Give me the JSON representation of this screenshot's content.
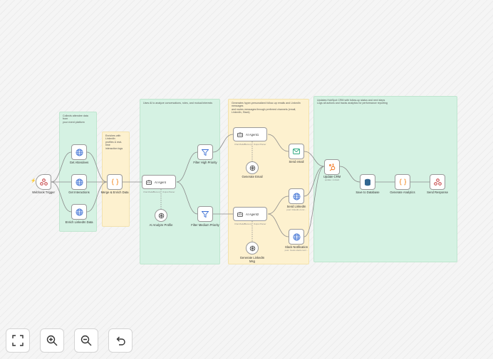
{
  "colors": {
    "green_note": "#d5f2e3",
    "yellow_note": "#fdf1cf",
    "accent": "#ff6d5a",
    "blue_icon": "#3b6fd4",
    "teal_icon": "#2aa87e",
    "orange_icon": "#f28c28"
  },
  "sticky_notes": [
    {
      "text": "Collects attendee data from\nyour event platform"
    },
    {
      "text": "Enriches with LinkedIn\nprofiles & real-time\ninteraction logs"
    },
    {
      "text": "Uses AI to analyze conversations, roles, and mutual interests"
    },
    {
      "text": "Generates hyper-personalized follow-up emails and LinkedIn messages\nand routes messages through preferred channels (email, LinkedIn, Slack)"
    },
    {
      "text": "Updates HubSpot CRM with follow-up status and next steps\nLogs all actions and tracks analytics for performance reporting"
    }
  ],
  "nodes": {
    "webhook_trigger": {
      "label": "Webhook Trigger",
      "icon": "webhook-icon"
    },
    "get_attendees": {
      "label": "Get Attendees",
      "icon": "globe-icon"
    },
    "get_interactions": {
      "label": "Get Interactions",
      "icon": "globe-icon"
    },
    "enrich_linkedin": {
      "label": "Enrich LinkedIn Data",
      "icon": "globe-icon"
    },
    "merge_enrich": {
      "label": "Merge & Enrich Data",
      "icon": "code-braces-icon"
    },
    "ai_agent": {
      "label": "AI Agent",
      "icon": "robot-icon"
    },
    "ai_analyze_profile": {
      "label": "AI Analyze Profile",
      "icon": "openai-icon"
    },
    "filter_high": {
      "label": "Filter High Priority",
      "icon": "filter-icon"
    },
    "filter_medium": {
      "label": "Filter Medium Priority",
      "icon": "filter-icon"
    },
    "ai_agent1": {
      "label": "AI Agent1",
      "icon": "robot-icon"
    },
    "generate_email": {
      "label": "Generate Email",
      "icon": "openai-icon"
    },
    "ai_agent2": {
      "label": "AI Agent2",
      "icon": "robot-icon"
    },
    "generate_linkedin": {
      "label": "Generate LinkedIn\nMsg",
      "icon": "openai-icon"
    },
    "send_email": {
      "label": "Send email",
      "icon": "mail-icon"
    },
    "send_linkedin": {
      "label": "Send LinkedIn",
      "sub": "post: linkedin.com/...",
      "icon": "globe-icon"
    },
    "slack_notification": {
      "label": "Slack Notification",
      "sub": "post: hooks.slack.com/...",
      "icon": "globe-icon"
    },
    "update_crm": {
      "label": "Update CRM",
      "sub": "update: contact",
      "icon": "hubspot-icon"
    },
    "save_database": {
      "label": "Save to Database",
      "icon": "database-icon"
    },
    "generate_analytics": {
      "label": "Generate Analytics",
      "icon": "code-braces-icon"
    },
    "send_response": {
      "label": "Send Response",
      "icon": "webhook-icon"
    }
  },
  "port_labels": {
    "chat_model": "Chat Model*",
    "memory": "Memory",
    "tool": "Tool",
    "output_parser": "Output Parser",
    "model": "Model"
  },
  "toolbar": [
    {
      "name": "fit-view-button",
      "icon": "fit-view-icon"
    },
    {
      "name": "zoom-in-button",
      "icon": "zoom-in-icon"
    },
    {
      "name": "zoom-out-button",
      "icon": "zoom-out-icon"
    },
    {
      "name": "reset-zoom-button",
      "icon": "undo-icon"
    }
  ]
}
